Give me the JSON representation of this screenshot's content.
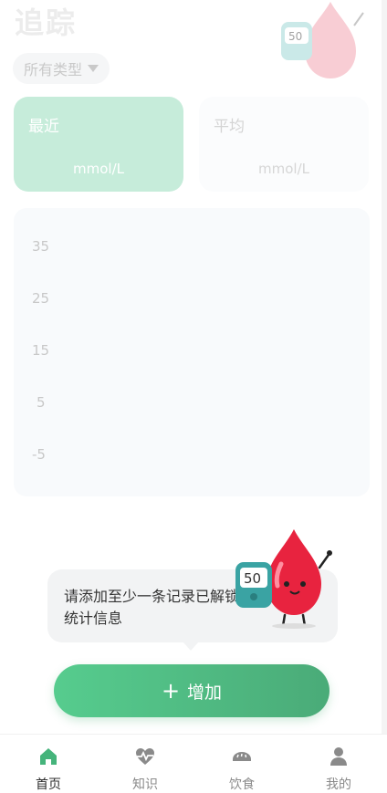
{
  "header": {
    "title": "追踪"
  },
  "filter": {
    "label": "所有类型"
  },
  "cards": {
    "recent": {
      "label": "最近",
      "unit": "mmol/L"
    },
    "average": {
      "label": "平均",
      "unit": "mmol/L"
    }
  },
  "chart_data": {
    "type": "line",
    "y_ticks": [
      "35",
      "25",
      "15",
      "5",
      "-5"
    ],
    "ylim": [
      -5,
      35
    ],
    "series": []
  },
  "prompt": {
    "text": "请添加至少一条记录已解锁统计信息"
  },
  "add_button": {
    "label": "增加"
  },
  "tabs": [
    {
      "label": "首页",
      "icon": "home-icon",
      "active": true
    },
    {
      "label": "知识",
      "icon": "heartbeat-icon",
      "active": false
    },
    {
      "label": "饮食",
      "icon": "bread-icon",
      "active": false
    },
    {
      "label": "我的",
      "icon": "user-icon",
      "active": false
    }
  ],
  "colors": {
    "accent": "#4fbb83",
    "active_tab": "#45b47b",
    "mascot": "#e8233f",
    "meter": "#3aa3a3"
  }
}
